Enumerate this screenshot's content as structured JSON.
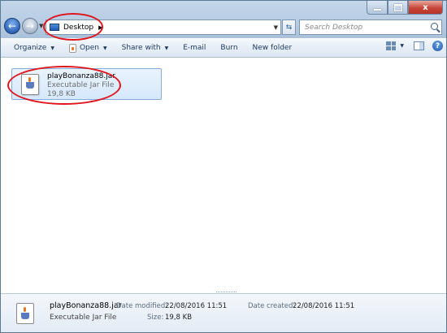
{
  "window_controls": {
    "minimize": "—",
    "maximize": "□",
    "close": "x"
  },
  "address": {
    "location": "Desktop"
  },
  "search": {
    "placeholder": "Search Desktop"
  },
  "toolbar": {
    "organize": "Organize",
    "open": "Open",
    "share_with": "Share with",
    "email": "E-mail",
    "burn": "Burn",
    "new_folder": "New folder"
  },
  "file": {
    "name": "playBonanza88.jar",
    "type": "Executable Jar File",
    "size": "19,8 KB"
  },
  "details": {
    "name": "playBonanza88.jar",
    "type": "Executable Jar File",
    "date_modified_label": "Date modified:",
    "date_modified": "22/08/2016 11:51",
    "size_label": "Size:",
    "size": "19,8 KB",
    "date_created_label": "Date created:",
    "date_created": "22/08/2016 11:51"
  },
  "annotation_color": "#e0151b"
}
